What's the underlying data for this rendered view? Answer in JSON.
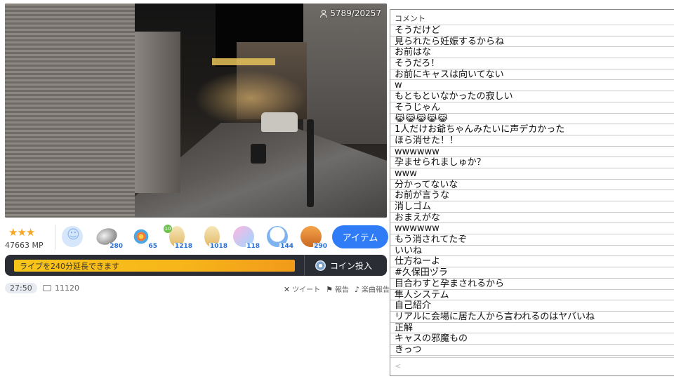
{
  "video": {
    "viewers": "5789/20257"
  },
  "rank": {
    "stars": "★★★",
    "mp": "47663 MP"
  },
  "gifts": [
    {
      "name": "smile",
      "count": ""
    },
    {
      "name": "coin",
      "count": "280"
    },
    {
      "name": "fireworks",
      "count": "65"
    },
    {
      "name": "card",
      "count": "1218",
      "badge": "10"
    },
    {
      "name": "card2",
      "count": "1018"
    },
    {
      "name": "ghost",
      "count": "118"
    },
    {
      "name": "ghost2",
      "count": "144"
    },
    {
      "name": "cone",
      "count": "290"
    }
  ],
  "item_button": "アイテム",
  "extension": {
    "label": "ライブを240分延長できます",
    "coin_button": "コイン投入"
  },
  "meta": {
    "time": "27:50",
    "comments": "11120",
    "tweet": "ツイート",
    "report": "報告",
    "music": "楽曲報告"
  },
  "comment_panel": {
    "header": "コメント",
    "comments": [
      "そうだけど",
      "見られたら妊娠するからね",
      "お前はな",
      "そうだろ！",
      "お前にキャスは向いてない",
      "w",
      "もともといなかったの寂しい",
      "そうじゃん",
      "😹😹😹😹😹",
      "1人だけお爺ちゃんみたいに声デカかった",
      "ほら消せた！！",
      "wwwwww",
      "孕ませられましゅか？",
      "www",
      "分かってないな",
      "お前が言うな",
      "消しゴム",
      "おまえがな",
      "wwwwww",
      "もう消されてたぞ",
      "いいね",
      "仕方ねーよ",
      "#久保田ヅラ",
      "目合わすと孕まされるから",
      "隼人システム",
      "自己紹介",
      "リアルに会場に居た人から言われるのはヤバいね",
      "正解",
      "キャスの邪魔もの",
      "きっつ"
    ],
    "footer": "<"
  }
}
